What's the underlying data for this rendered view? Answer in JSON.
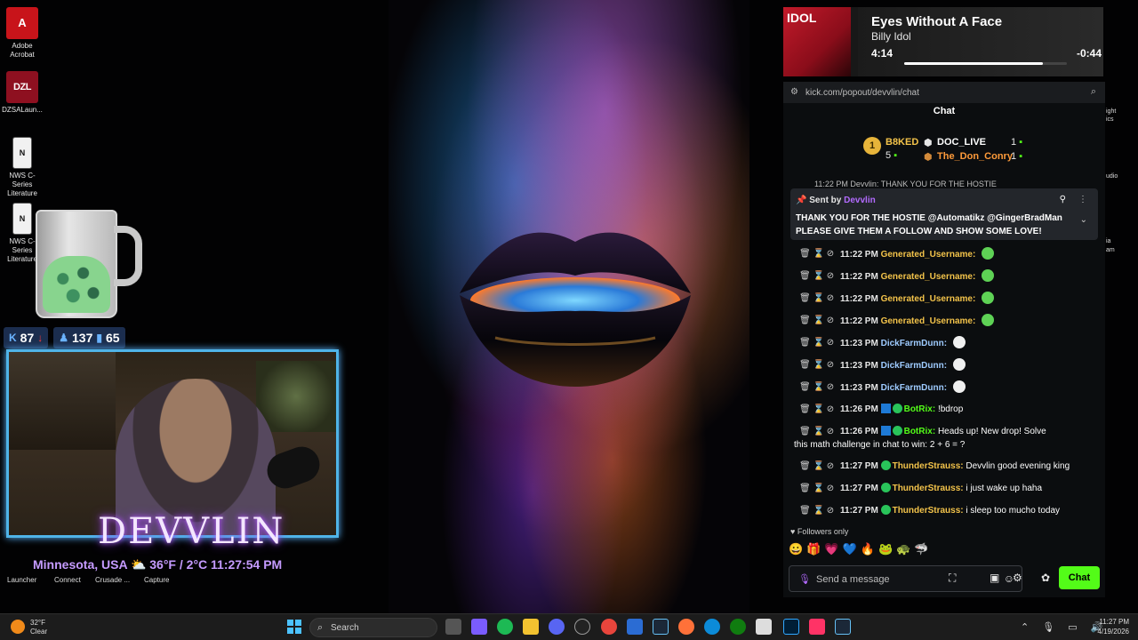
{
  "desktop": {
    "icons": [
      {
        "label": "Adobe Acrobat",
        "glyph": "A"
      },
      {
        "label": "DZSALaun...",
        "glyph": "DZL"
      },
      {
        "label": "NWS C-Series Literature",
        "glyph": "N"
      },
      {
        "label": "NWS C-Series Literature",
        "glyph": "N"
      }
    ],
    "bottom_icons": [
      "Launcher",
      "Connect",
      "Crusade ...",
      "Capture"
    ]
  },
  "stream_overlay": {
    "stats": {
      "kills": "87",
      "players": "137",
      "viewers": "65"
    },
    "name": "DEVVLIN",
    "location": "Minnesota, USA",
    "weather": "36°F / 2°C",
    "time": "11:27:54 PM"
  },
  "now_playing": {
    "cover_text": "IDOL",
    "title": "Eyes Without A Face",
    "artist": "Billy Idol",
    "elapsed": "4:14",
    "remaining": "-0:44",
    "progress": 0.85
  },
  "browser": {
    "url": "kick.com/popout/devvlin/chat"
  },
  "chat": {
    "header": "Chat",
    "leaderboard": {
      "first": {
        "rank": "1",
        "name": "B8KED",
        "count": "5"
      },
      "second": {
        "name": "DOC_LIVE",
        "count": "1"
      },
      "third": {
        "name": "The_Don_Conry",
        "count": "1"
      }
    },
    "scroll_cut": "11:22 PM  Devvlin: THANK YOU FOR THE HOSTIE",
    "pinned": {
      "sent_by_label": "Sent by",
      "sender": "Devvlin",
      "message": "THANK YOU FOR THE HOSTIE @Automatikz @GingerBradMan PLEASE GIVE THEM A FOLLOW AND SHOW SOME LOVE!"
    },
    "messages": [
      {
        "time": "11:22 PM",
        "user": "Generated_Username:",
        "color": "#f3c34a",
        "text": ""
      },
      {
        "time": "11:22 PM",
        "user": "Generated_Username:",
        "color": "#f3c34a",
        "text": ""
      },
      {
        "time": "11:22 PM",
        "user": "Generated_Username:",
        "color": "#f3c34a",
        "text": ""
      },
      {
        "time": "11:22 PM",
        "user": "Generated_Username:",
        "color": "#f3c34a",
        "text": ""
      },
      {
        "time": "11:23 PM",
        "user": "DickFarmDunn:",
        "color": "#9ecbff",
        "text": ""
      },
      {
        "time": "11:23 PM",
        "user": "DickFarmDunn:",
        "color": "#9ecbff",
        "text": ""
      },
      {
        "time": "11:23 PM",
        "user": "DickFarmDunn:",
        "color": "#9ecbff",
        "text": ""
      },
      {
        "time": "11:26 PM",
        "user": "BotRix:",
        "color": "#53fc18",
        "text": "!bdrop"
      },
      {
        "time": "11:26 PM",
        "user": "BotRix:",
        "color": "#53fc18",
        "text": "Heads up! New drop!  Solve"
      },
      {
        "time": "11:27 PM",
        "user": "ThunderStrauss:",
        "color": "#f3c34a",
        "text": "Devvlin good evening king"
      },
      {
        "time": "11:27 PM",
        "user": "ThunderStrauss:",
        "color": "#f3c34a",
        "text": "i just wake up haha"
      },
      {
        "time": "11:27 PM",
        "user": "ThunderStrauss:",
        "color": "#f3c34a",
        "text": "i sleep too mucho today"
      }
    ],
    "botrix_continuation": "this math challenge in chat to win: 2 + 6 = ?",
    "followers_only": "Followers only",
    "input_placeholder": "Send a message",
    "send_label": "Chat"
  },
  "edge_labels": [
    "ight",
    "ics",
    "udio",
    "ia",
    "am"
  ],
  "taskbar": {
    "weather_temp": "32°F",
    "weather_cond": "Clear",
    "search_label": "Search",
    "time": "11:27 PM",
    "date": "4/19/2026"
  },
  "colors": {
    "kick_green": "#53fc18",
    "gold": "#f3c34a",
    "purple": "#b36bff"
  }
}
